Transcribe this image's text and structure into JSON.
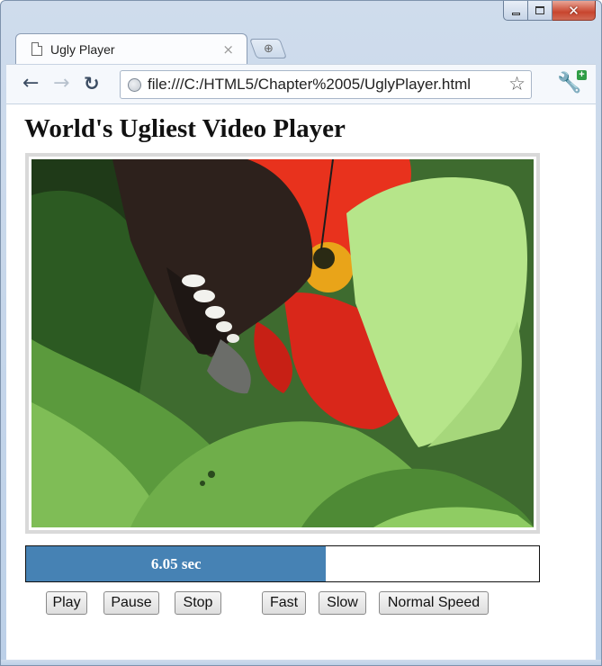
{
  "browser": {
    "tab_title": "Ugly Player",
    "tab_close_glyph": "×",
    "new_tab_glyph": "⊕",
    "url": "file:///C:/HTML5/Chapter%2005/UglyPlayer.html",
    "icons": {
      "back": "back-arrow-icon",
      "forward": "forward-arrow-icon",
      "reload": "reload-icon",
      "page": "page-icon",
      "globe": "globe-icon",
      "star": "star-icon",
      "wrench": "wrench-icon"
    },
    "window_controls": [
      "minimize",
      "maximize",
      "close"
    ]
  },
  "page": {
    "title": "World's Ugliest Video Player",
    "video": {
      "description_icon": "video-frame"
    },
    "progress": {
      "label": "6.05 sec",
      "fraction": 0.585,
      "fill_color": "#4682b4"
    },
    "buttons": {
      "play": "Play",
      "pause": "Pause",
      "stop": "Stop",
      "fast": "Fast",
      "slow": "Slow",
      "normal_speed": "Normal Speed"
    }
  }
}
